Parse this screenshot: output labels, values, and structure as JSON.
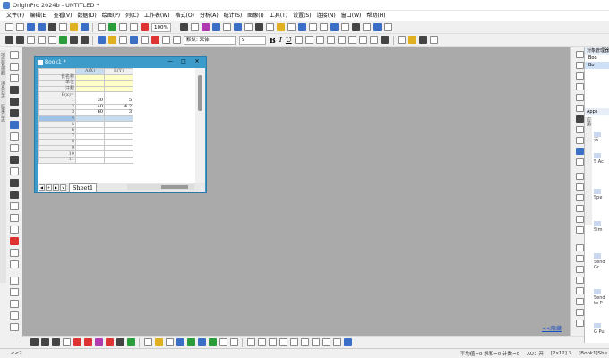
{
  "window": {
    "title": "OriginPro 2024b - UNTITLED *"
  },
  "menu": [
    "文件(F)",
    "编辑(E)",
    "查看(V)",
    "数据(D)",
    "绘图(P)",
    "列(C)",
    "工作表(W)",
    "格式(O)",
    "分析(A)",
    "统计(S)",
    "图像(I)",
    "工具(T)",
    "设置(S)",
    "连接(N)",
    "窗口(W)",
    "帮助(H)"
  ],
  "toolbar": {
    "zoom": "100%",
    "font": "默认: 宋体",
    "font_size": "9"
  },
  "book": {
    "title": "Book1 *",
    "columns": [
      "A(X)",
      "B(Y)"
    ],
    "meta_rows": [
      "长名称",
      "单位",
      "注释",
      "F(x)="
    ],
    "rows": [
      {
        "n": "1",
        "a": "30",
        "b": "5"
      },
      {
        "n": "2",
        "a": "40",
        "b": "4.2"
      },
      {
        "n": "3",
        "a": "60",
        "b": "3"
      },
      {
        "n": "4",
        "a": "",
        "b": ""
      },
      {
        "n": "5",
        "a": "",
        "b": ""
      },
      {
        "n": "6",
        "a": "",
        "b": ""
      },
      {
        "n": "7",
        "a": "",
        "b": ""
      },
      {
        "n": "8",
        "a": "",
        "b": ""
      },
      {
        "n": "9",
        "a": "",
        "b": ""
      },
      {
        "n": "10",
        "a": "",
        "b": ""
      },
      {
        "n": "11",
        "a": "",
        "b": ""
      }
    ],
    "sheet_tab": "Sheet1",
    "nav": [
      "◀",
      "+",
      "▶",
      "∨"
    ]
  },
  "workspace": {
    "collapse_link": "<<隐藏"
  },
  "left_tabs": [
    "项目管理器",
    "消息日志",
    "结果日志"
  ],
  "project_manager": {
    "header": "对象管理器",
    "items": [
      "Boo",
      "Bo"
    ]
  },
  "apps": {
    "header": "Apps",
    "tab": "应用",
    "entries": [
      "添",
      "S Ac",
      "Spe",
      "Sim",
      "Send Gr",
      "Send to P",
      "G Pu"
    ]
  },
  "status": {
    "mode": "<<2",
    "stats": "平均值=0 求和=0 计数=0",
    "au": "AU：开",
    "cell": "[2x12] 3",
    "sheet": "[Book1]She"
  }
}
